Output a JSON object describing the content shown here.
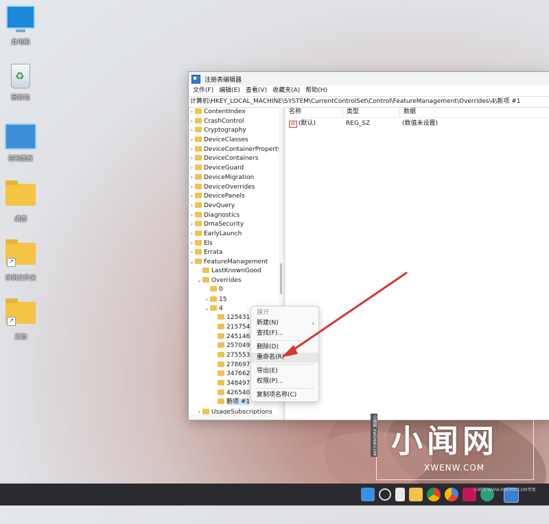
{
  "desktop": {
    "icons": [
      {
        "label": "此电脑",
        "icon": "computer-icon"
      },
      {
        "label": "回收站",
        "icon": "recycle-bin-icon"
      },
      {
        "label": "控制面板",
        "icon": "control-panel-icon"
      },
      {
        "label": "桌面",
        "icon": "folder-icon"
      },
      {
        "label": "示例文件夹",
        "icon": "folder-shortcut-icon"
      },
      {
        "label": "文档",
        "icon": "folder-shortcut-icon"
      }
    ]
  },
  "window": {
    "title": "注册表编辑器",
    "menu": [
      "文件(F)",
      "编辑(E)",
      "查看(V)",
      "收藏夹(A)",
      "帮助(H)"
    ],
    "address": "计算机\\HKEY_LOCAL_MACHINE\\SYSTEM\\CurrentControlSet\\Control\\FeatureManagement\\Overrides\\4\\新项 #1",
    "tree": [
      {
        "label": "ContentIndex",
        "depth": 0,
        "exp": ">"
      },
      {
        "label": "CrashControl",
        "depth": 0,
        "exp": ">"
      },
      {
        "label": "Cryptography",
        "depth": 0,
        "exp": ">"
      },
      {
        "label": "DeviceClasses",
        "depth": 0,
        "exp": ">"
      },
      {
        "label": "DeviceContainerPropertyUpda",
        "depth": 0,
        "exp": ">"
      },
      {
        "label": "DeviceContainers",
        "depth": 0,
        "exp": ">"
      },
      {
        "label": "DeviceGuard",
        "depth": 0,
        "exp": ">"
      },
      {
        "label": "DeviceMigration",
        "depth": 0,
        "exp": ">"
      },
      {
        "label": "DeviceOverrides",
        "depth": 0,
        "exp": ">"
      },
      {
        "label": "DevicePanels",
        "depth": 0,
        "exp": ">"
      },
      {
        "label": "DevQuery",
        "depth": 0,
        "exp": ">"
      },
      {
        "label": "Diagnostics",
        "depth": 0,
        "exp": ">"
      },
      {
        "label": "DmaSecurity",
        "depth": 0,
        "exp": ">"
      },
      {
        "label": "EarlyLaunch",
        "depth": 0,
        "exp": ">"
      },
      {
        "label": "Els",
        "depth": 0,
        "exp": ">"
      },
      {
        "label": "Errata",
        "depth": 0,
        "exp": ">"
      },
      {
        "label": "FeatureManagement",
        "depth": 0,
        "exp": "v"
      },
      {
        "label": "LastKnownGood",
        "depth": 1,
        "exp": ""
      },
      {
        "label": "Overrides",
        "depth": 1,
        "exp": "v"
      },
      {
        "label": "0",
        "depth": 2,
        "exp": ""
      },
      {
        "label": "15",
        "depth": 2,
        "exp": ">"
      },
      {
        "label": "4",
        "depth": 2,
        "exp": "v"
      },
      {
        "label": "125431",
        "depth": 3,
        "exp": ""
      },
      {
        "label": "215754",
        "depth": 3,
        "exp": ""
      },
      {
        "label": "245146",
        "depth": 3,
        "exp": ""
      },
      {
        "label": "257049",
        "depth": 3,
        "exp": ""
      },
      {
        "label": "275553",
        "depth": 3,
        "exp": ""
      },
      {
        "label": "278697",
        "depth": 3,
        "exp": ""
      },
      {
        "label": "347662",
        "depth": 3,
        "exp": ""
      },
      {
        "label": "348497",
        "depth": 3,
        "exp": ""
      },
      {
        "label": "426540",
        "depth": 3,
        "exp": ""
      },
      {
        "label": "新项 #1",
        "depth": 3,
        "exp": "",
        "selected": true
      },
      {
        "label": "UsageSubscriptions",
        "depth": 1,
        "exp": ">"
      }
    ],
    "columns": [
      "名称",
      "类型",
      "数据"
    ],
    "rows": [
      {
        "name": "(默认)",
        "type": "REG_SZ",
        "data": "(数值未设置)",
        "icon": "ab-icon"
      }
    ]
  },
  "context_menu": {
    "items": [
      {
        "label": "展开",
        "disabled": true
      },
      {
        "label": "新建(N)",
        "submenu": true
      },
      {
        "label": "查找(F)..."
      },
      {
        "sep": true
      },
      {
        "label": "删除(D)"
      },
      {
        "label": "重命名(R)",
        "highlight": true
      },
      {
        "sep": true
      },
      {
        "label": "导出(E)"
      },
      {
        "label": "权限(P)..."
      },
      {
        "sep": true
      },
      {
        "label": "复制项名称(C)"
      }
    ]
  },
  "annotation": {
    "color": "#d9342b"
  },
  "watermark": {
    "big": "小闻网",
    "small": "XWENW.COM",
    "side": "小闻网 XWENW.COM"
  },
  "taskbar": {
    "url": "小闻网 WWW.XWENW.COM专用",
    "icons": [
      "start-icon",
      "search-icon",
      "taskview-icon",
      "explorer-icon",
      "chrome-icon",
      "browser-icon",
      "office-icon",
      "edge-icon",
      "regedit-icon"
    ]
  }
}
